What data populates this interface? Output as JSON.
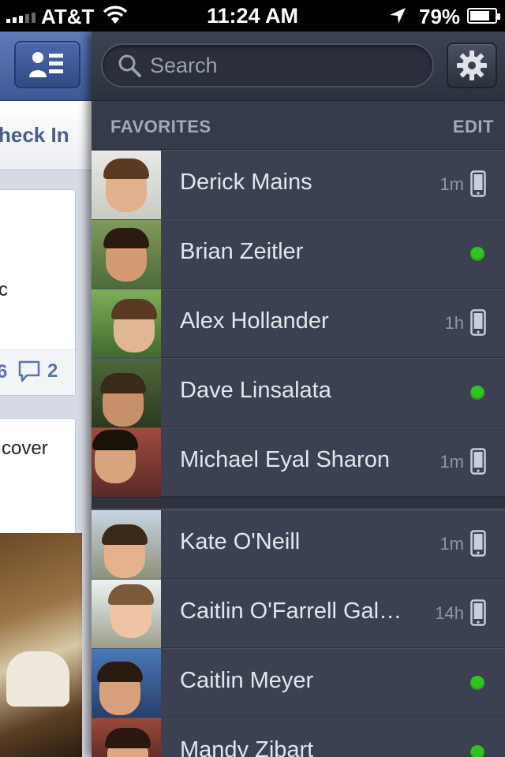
{
  "status_bar": {
    "carrier": "AT&T",
    "time": "11:24 AM",
    "battery_percent": "79%",
    "battery_level": 0.79,
    "icons": [
      "signal-icon",
      "wifi-icon",
      "location-arrow-icon",
      "battery-icon"
    ]
  },
  "feed": {
    "tab_label": "heck In",
    "story1_text": "c",
    "story1_likes": "6",
    "story1_comments": "2",
    "story2_text": "cover"
  },
  "sidebar": {
    "search_placeholder": "Search",
    "section_title": "FAVORITES",
    "edit_label": "EDIT",
    "favorites": [
      {
        "name": "Derick Mains",
        "time": "1m",
        "status": "mobile"
      },
      {
        "name": "Brian Zeitler",
        "time": "",
        "status": "online"
      },
      {
        "name": "Alex Hollander",
        "time": "1h",
        "status": "mobile"
      },
      {
        "name": "Dave Linsalata",
        "time": "",
        "status": "online"
      },
      {
        "name": "Michael Eyal Sharon",
        "time": "1m",
        "status": "mobile"
      }
    ],
    "others": [
      {
        "name": "Kate O'Neill",
        "time": "1m",
        "status": "mobile"
      },
      {
        "name": "Caitlin O'Farrell Gal…",
        "time": "14h",
        "status": "mobile"
      },
      {
        "name": "Caitlin Meyer",
        "time": "",
        "status": "online"
      },
      {
        "name": "Mandy Zibart",
        "time": "",
        "status": "online"
      }
    ]
  },
  "colors": {
    "sidebar_bg": "#3b4150",
    "online_green": "#2fc51f",
    "facebook_blue": "#3d5a98"
  }
}
